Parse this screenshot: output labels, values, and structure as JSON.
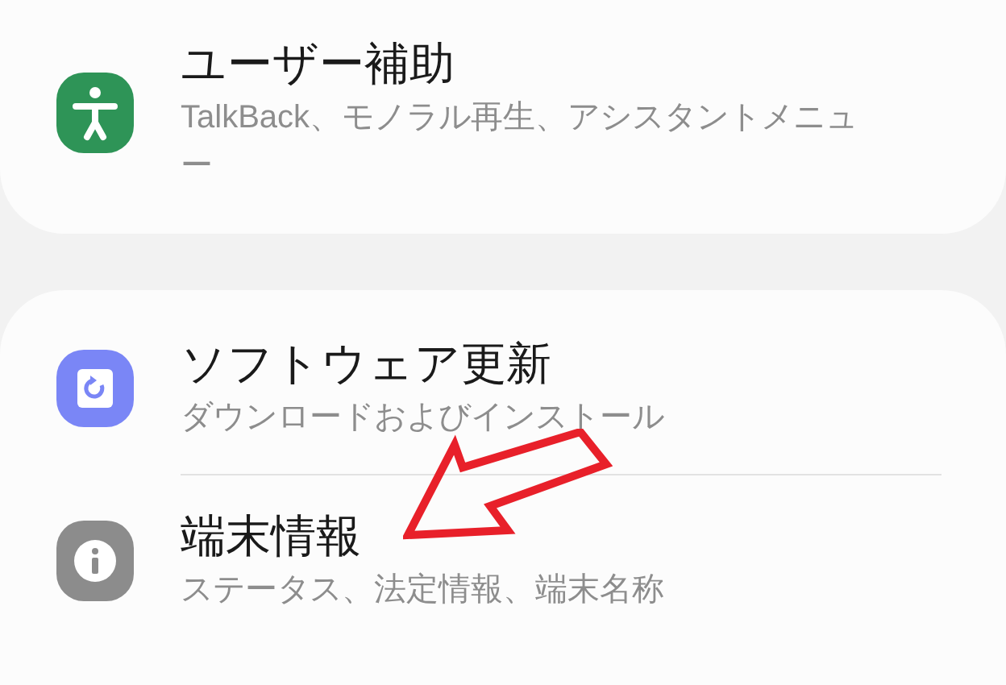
{
  "sections": [
    {
      "items": [
        {
          "title": "ユーザー補助",
          "subtitle": "TalkBack、モノラル再生、アシスタントメニュー"
        }
      ]
    },
    {
      "items": [
        {
          "title": "ソフトウェア更新",
          "subtitle": "ダウンロードおよびインストール"
        },
        {
          "title": "端末情報",
          "subtitle": "ステータス、法定情報、端末名称"
        }
      ]
    }
  ]
}
